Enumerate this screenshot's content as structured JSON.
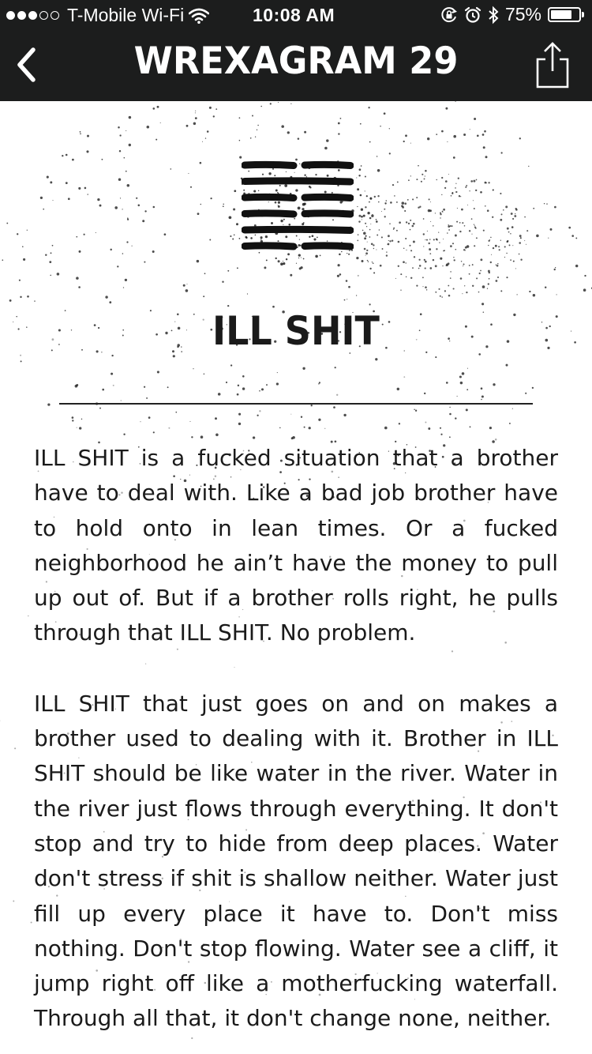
{
  "status_bar": {
    "carrier": "T-Mobile Wi-Fi",
    "time": "10:08 AM",
    "battery_percent": "75%",
    "battery_level": 0.75,
    "signal_strength": 3,
    "signal_max": 5,
    "icons": [
      "wifi-icon",
      "orientation-lock-icon",
      "alarm-icon",
      "bluetooth-icon",
      "battery-icon"
    ]
  },
  "nav": {
    "title": "WREXAGRAM 29",
    "back_icon": "chevron-left-icon",
    "share_icon": "share-icon"
  },
  "card": {
    "title": "ILL SHIT",
    "hexagram_lines": [
      "broken",
      "solid",
      "broken",
      "broken",
      "solid",
      "broken"
    ],
    "paragraphs": [
      "ILL SHIT is a fucked situation that a brother have to deal with. Like a bad job brother have to hold onto in lean times. Or a fucked neighborhood he ain’t have the money to pull up out of. But if a brother rolls right, he pulls through that ILL SHIT. No problem.",
      "ILL SHIT that just goes on and on makes a brother used to dealing with it. Brother in ILL SHIT should be like water in the river. Water in the river just flows through everything. It don't stop and try to hide from deep places. Water don't stress if shit is shallow neither. Water just fill up every place it have to. Don't miss nothing. Don't stop flowing. Water see a cliff, it jump right off like a motherfucking waterfall. Through all that, it don't change none, neither."
    ]
  },
  "colors": {
    "bar_background": "#1c1d1d",
    "bar_foreground": "#ffffff",
    "text": "#1a1a1a",
    "page_background": "#ffffff"
  }
}
